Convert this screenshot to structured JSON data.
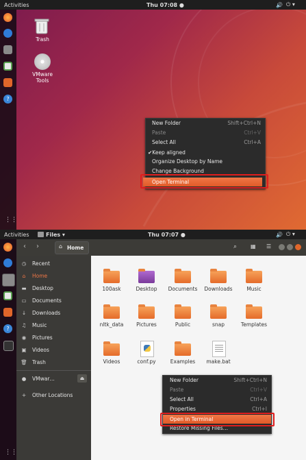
{
  "top": {
    "panel": {
      "activities": "Activities",
      "clock": "Thu 07:08 ●"
    },
    "desktop_icons": [
      {
        "label": "Trash"
      },
      {
        "label": "VMware Tools"
      }
    ],
    "context_menu": {
      "items": [
        {
          "label": "New Folder",
          "shortcut": "Shift+Ctrl+N"
        },
        {
          "label": "Paste",
          "shortcut": "Ctrl+V"
        },
        {
          "label": "Select All",
          "shortcut": "Ctrl+A"
        },
        {
          "label": "✔Keep aligned"
        },
        {
          "label": "Organize Desktop by Name"
        },
        {
          "label": "Change Background"
        },
        {
          "label": "Open Terminal"
        }
      ]
    }
  },
  "bottom": {
    "panel": {
      "activities": "Activities",
      "app": "Files ▾",
      "clock": "Thu 07:07 ●"
    },
    "toolbar": {
      "location": "Home"
    },
    "sidebar": {
      "items": [
        {
          "label": "Recent",
          "icon": "clock-icon"
        },
        {
          "label": "Home",
          "icon": "home-icon"
        },
        {
          "label": "Desktop",
          "icon": "folder-icon"
        },
        {
          "label": "Documents",
          "icon": "document-icon"
        },
        {
          "label": "Downloads",
          "icon": "download-icon"
        },
        {
          "label": "Music",
          "icon": "music-icon"
        },
        {
          "label": "Pictures",
          "icon": "camera-icon"
        },
        {
          "label": "Videos",
          "icon": "video-icon"
        },
        {
          "label": "Trash",
          "icon": "trash-icon"
        },
        {
          "label": "VMwar…",
          "icon": "disc-icon"
        },
        {
          "label": "Other Locations",
          "icon": "plus-icon"
        }
      ]
    },
    "files": [
      {
        "name": "100ask"
      },
      {
        "name": "Desktop"
      },
      {
        "name": "Documents"
      },
      {
        "name": "Downloads"
      },
      {
        "name": "Music"
      },
      {
        "name": "nltk_data"
      },
      {
        "name": "Pictures"
      },
      {
        "name": "Public"
      },
      {
        "name": "snap"
      },
      {
        "name": "Templates"
      },
      {
        "name": "Videos"
      },
      {
        "name": "conf.py"
      },
      {
        "name": "Examples"
      },
      {
        "name": "make.bat"
      }
    ],
    "context_menu": {
      "items": [
        {
          "label": "New Folder",
          "shortcut": "Shift+Ctrl+N"
        },
        {
          "label": "Paste",
          "shortcut": "Ctrl+V"
        },
        {
          "label": "Select All",
          "shortcut": "Ctrl+A"
        },
        {
          "label": "Properties",
          "shortcut": "Ctrl+I"
        },
        {
          "label": "Open in Terminal"
        },
        {
          "label": "Restore Missing Files…"
        }
      ]
    }
  }
}
